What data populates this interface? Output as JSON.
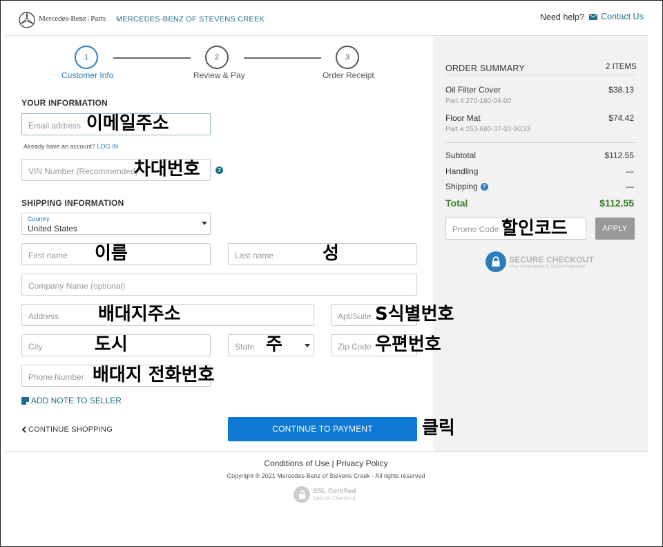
{
  "header": {
    "brand": "Mercedes-Benz",
    "brand_sub": "Parts",
    "dealer": "MERCEDES-BENZ OF STEVENS CREEK",
    "need_help": "Need help?",
    "contact": "Contact Us"
  },
  "steps": [
    {
      "num": "1",
      "label": "Customer Info"
    },
    {
      "num": "2",
      "label": "Review & Pay"
    },
    {
      "num": "3",
      "label": "Order Receipt"
    }
  ],
  "your_info": {
    "title": "YOUR INFORMATION",
    "email_placeholder": "Email address",
    "email_note": "이메일주소",
    "account_text": "Already have an account?",
    "login": "LOG IN",
    "vin_placeholder": "VIN Number (Recommended)",
    "vin_note": "차대번호"
  },
  "shipping": {
    "title": "SHIPPING INFORMATION",
    "country_label": "Country",
    "country_value": "United States",
    "first_name": "First name",
    "first_name_note": "이름",
    "last_name": "Last name",
    "last_name_note": "성",
    "company": "Company Name (optional)",
    "address": "Address",
    "address_note": "배대지주소",
    "apt": "Apt/Suite",
    "apt_note": "S식별번호",
    "city": "City",
    "city_note": "도시",
    "state": "State",
    "state_note": "주",
    "zip": "Zip Code",
    "zip_note": "우편번호",
    "phone": "Phone Number",
    "phone_note": "배대지 전화번호"
  },
  "actions": {
    "add_note": "ADD NOTE TO SELLER",
    "continue_shopping": "CONTINUE SHOPPING",
    "continue_payment": "CONTINUE TO PAYMENT",
    "click_note": "클릭"
  },
  "summary": {
    "title": "ORDER SUMMARY",
    "count": "2 ITEMS",
    "items": [
      {
        "name": "Oil Filter Cover",
        "part": "Part # 270-180-04-00",
        "price": "$38.13"
      },
      {
        "name": "Floor Mat",
        "part": "Part # 253-680-37-03-9G33",
        "price": "$74.42"
      }
    ],
    "subtotal_label": "Subtotal",
    "subtotal": "$112.55",
    "handling_label": "Handling",
    "handling": "—",
    "shipping_label": "Shipping",
    "shipping": "—",
    "total_label": "Total",
    "total": "$112.55",
    "promo_placeholder": "Promo Code",
    "promo_note": "할인코드",
    "apply": "APPLY",
    "secure_title": "SECURE CHECKOUT",
    "secure_sub": "Your Information is 100% Protected"
  },
  "footer": {
    "links": "Conditions of Use | Privacy Policy",
    "copyright": "Copyright ® 2021 Mercedes-Benz of Stevens Creek - All rights reserved",
    "ssl_title": "SSL Certified",
    "ssl_sub": "Secure Checkout"
  },
  "colors": {
    "accent": "#2b7bbd",
    "button": "#0f78d4",
    "total": "#3a7d2c",
    "link": "#1f6f8b"
  }
}
